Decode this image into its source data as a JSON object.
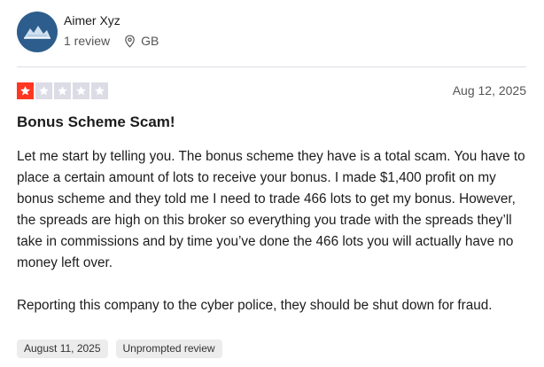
{
  "reviewer": {
    "name": "Aimer Xyz",
    "review_count": "1 review",
    "location": "GB"
  },
  "review": {
    "rating": 1,
    "max_rating": 5,
    "date": "Aug 12, 2025",
    "title": "Bonus Scheme Scam!",
    "body": [
      "Let me start by telling you. The bonus scheme they have is a total scam. You have to place a certain amount of lots to receive your bonus. I made $1,400 profit on my bonus scheme and they told me I need to trade 466 lots to get my bonus. However, the spreads are high on this broker so everything you trade with the spreads they’ll take in commissions and by time you’ve done the 466 lots you will actually have no money left over.",
      "Reporting this company to the cyber police, they should be shut down for fraud."
    ],
    "experience_date": "August 11, 2025",
    "review_type": "Unprompted review"
  },
  "colors": {
    "star_filled": "#ff3722",
    "star_empty": "#dcdce6",
    "avatar_bg": "#2d5d8c"
  },
  "icons": {
    "avatar": "reviewer-avatar-logo",
    "location": "location-pin-icon",
    "star": "star-icon"
  }
}
